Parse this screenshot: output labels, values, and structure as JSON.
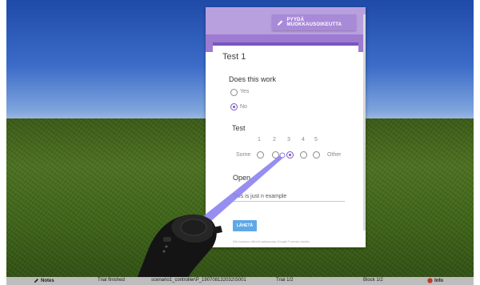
{
  "form": {
    "edit_button_label": "PYYDÄ MUOKKAUSOIKEUTTA",
    "title": "Test 1",
    "question1": {
      "label": "Does this work",
      "options": [
        "Yes",
        "No"
      ],
      "selected": "No"
    },
    "question2": {
      "label": "Test",
      "scale": [
        "1",
        "2",
        "3",
        "4",
        "5"
      ],
      "left_label": "Some",
      "right_label": "Other",
      "selected": "3"
    },
    "question3": {
      "label": "Open",
      "answer": "This is just n example"
    },
    "submit_label": "LÄHETÄ",
    "footer_note": "Älä koskaan lähetä salasanoja Google Formsin kautta."
  },
  "status_bar": {
    "notes": "Notes",
    "trial_status": "Trial finished",
    "scenario": "scenario1_controller\\P_190708132032\\S001",
    "trial": "Trial 1/2",
    "block": "Block 1/2",
    "info": "Info"
  },
  "colors": {
    "form_accent": "#7a55c0",
    "header": "#b8a0df",
    "submit": "#5fa8e8",
    "pointer_beam": "#8c82f0"
  }
}
